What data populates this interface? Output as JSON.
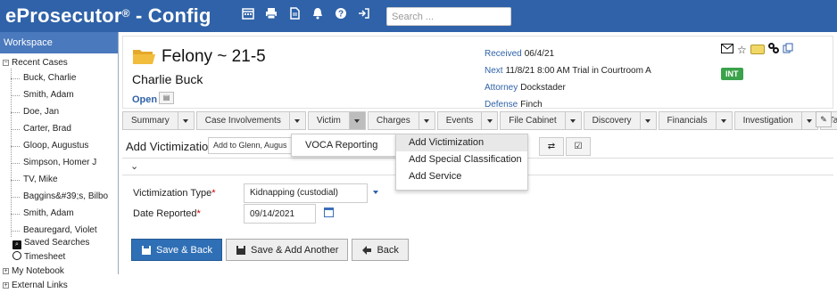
{
  "header": {
    "brand_prefix": "eProsecutor",
    "brand_reg": "®",
    "brand_suffix": " - Config",
    "search_placeholder": "Search ...",
    "icons": [
      "calendar-icon",
      "print-icon",
      "document-icon",
      "bell-icon",
      "help-icon",
      "logout-icon"
    ]
  },
  "sidebar": {
    "title": "Workspace",
    "recent_cases_label": "Recent Cases",
    "recent_cases": [
      "Buck, Charlie",
      "Smith, Adam",
      "Doe, Jan",
      "Carter, Brad",
      "Gloop, Augustus",
      "Simpson, Homer J",
      "TV, Mike",
      "Baggins&#39;s, Bilbo",
      "Smith, Adam",
      "Beauregard, Violet"
    ],
    "saved_searches": "Saved Searches",
    "timesheet": "Timesheet",
    "my_notebook": "My Notebook",
    "external_links": "External Links"
  },
  "case": {
    "title": "Felony ~ 21-5",
    "defendant": "Charlie Buck",
    "status": "Open",
    "received_label": "Received",
    "received_value": "06/4/21",
    "next_label": "Next",
    "next_value": "11/8/21 8:00 AM Trial in Courtroom A",
    "attorney_label": "Attorney",
    "attorney_value": "Dockstader",
    "defense_label": "Defense",
    "defense_value": "Finch",
    "badge": "INT"
  },
  "tabs": [
    "Summary",
    "Case Involvements",
    "Victim",
    "Charges",
    "Events",
    "File Cabinet",
    "Discovery",
    "Financials",
    "Investigation",
    "Tasks"
  ],
  "action_bar": {
    "title": "Add Victimization",
    "add_to": "Add to Glenn, Augus"
  },
  "victim_menu": [
    "VOCA Reporting"
  ],
  "add_menu": [
    "Add Victimization",
    "Add Special Classification",
    "Add Service"
  ],
  "form": {
    "victimization_type_label": "Victimization Type",
    "victimization_type_value": "Kidnapping (custodial)",
    "date_reported_label": "Date Reported",
    "date_reported_value": "09/14/2021",
    "required_mark": "*"
  },
  "buttons": {
    "save_back": "Save & Back",
    "save_add_another": "Save & Add Another",
    "back": "Back"
  }
}
